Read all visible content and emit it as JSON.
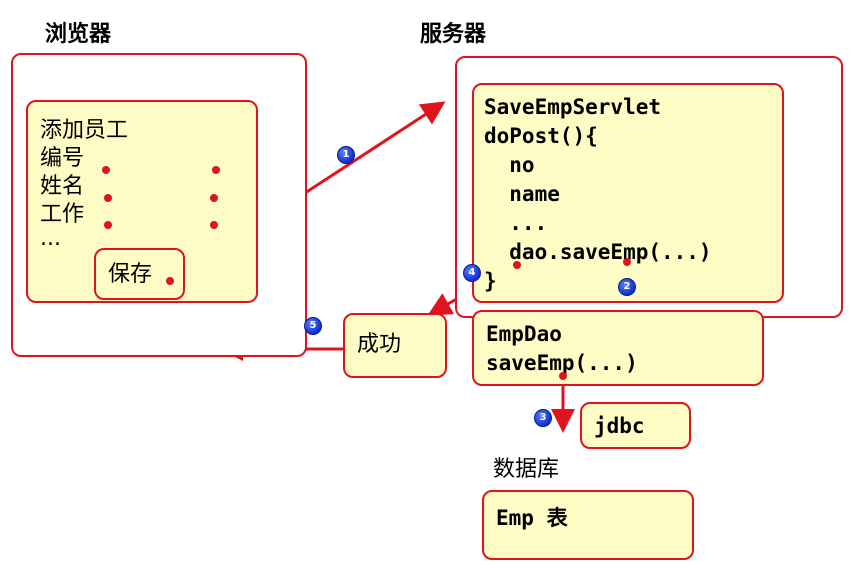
{
  "browser": {
    "title": "浏览器",
    "form": {
      "heading": "添加员工",
      "fields": [
        "编号",
        "姓名",
        "工作"
      ],
      "more": "...",
      "save_button": "保存"
    }
  },
  "server": {
    "title": "服务器",
    "servlet_lines": [
      "SaveEmpServlet",
      "doPost(){",
      "  no",
      "  name",
      "  ...",
      "  dao.saveEmp(...)",
      "}"
    ]
  },
  "success": {
    "label": "成功"
  },
  "dao": {
    "lines": [
      "EmpDao",
      "saveEmp(...)"
    ]
  },
  "jdbc": {
    "label": "jdbc"
  },
  "database": {
    "title": "数据库",
    "table_label": "Emp 表"
  },
  "steps": [
    "1",
    "2",
    "3",
    "4",
    "5"
  ],
  "colors": {
    "line": "#e0141e",
    "box_fill": "#fdfcc5",
    "badge": "#1030d0"
  }
}
